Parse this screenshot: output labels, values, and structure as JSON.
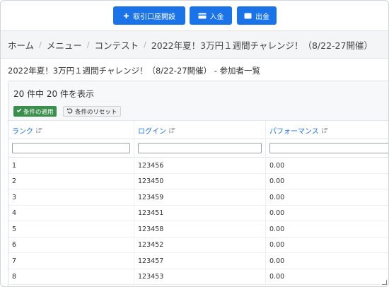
{
  "toolbar": {
    "open_account": "取引口座開設",
    "deposit": "入金",
    "withdraw": "出金"
  },
  "breadcrumb": {
    "items": [
      "ホーム",
      "メニュー",
      "コンテスト",
      "2022年夏！3万円１週間チャレンジ！（8/22-27開催）"
    ]
  },
  "page_title": "2022年夏！3万円１週間チャレンジ！（8/22-27開催） - 参加者一覧",
  "list": {
    "count_text": "20 件中 20 件を表示",
    "apply_label": "条件の適用",
    "reset_label": "条件のリセット",
    "columns": [
      "ランク",
      "ログイン",
      "パフォーマンス"
    ],
    "rows": [
      [
        "1",
        "123456",
        "0.00"
      ],
      [
        "2",
        "123450",
        "0.00"
      ],
      [
        "3",
        "123459",
        "0.00"
      ],
      [
        "4",
        "123451",
        "0.00"
      ],
      [
        "5",
        "123458",
        "0.00"
      ],
      [
        "6",
        "123452",
        "0.00"
      ],
      [
        "7",
        "123457",
        "0.00"
      ],
      [
        "8",
        "123453",
        "0.00"
      ]
    ]
  },
  "colors": {
    "primary": "#1a73e8",
    "success": "#3a8f4c"
  }
}
